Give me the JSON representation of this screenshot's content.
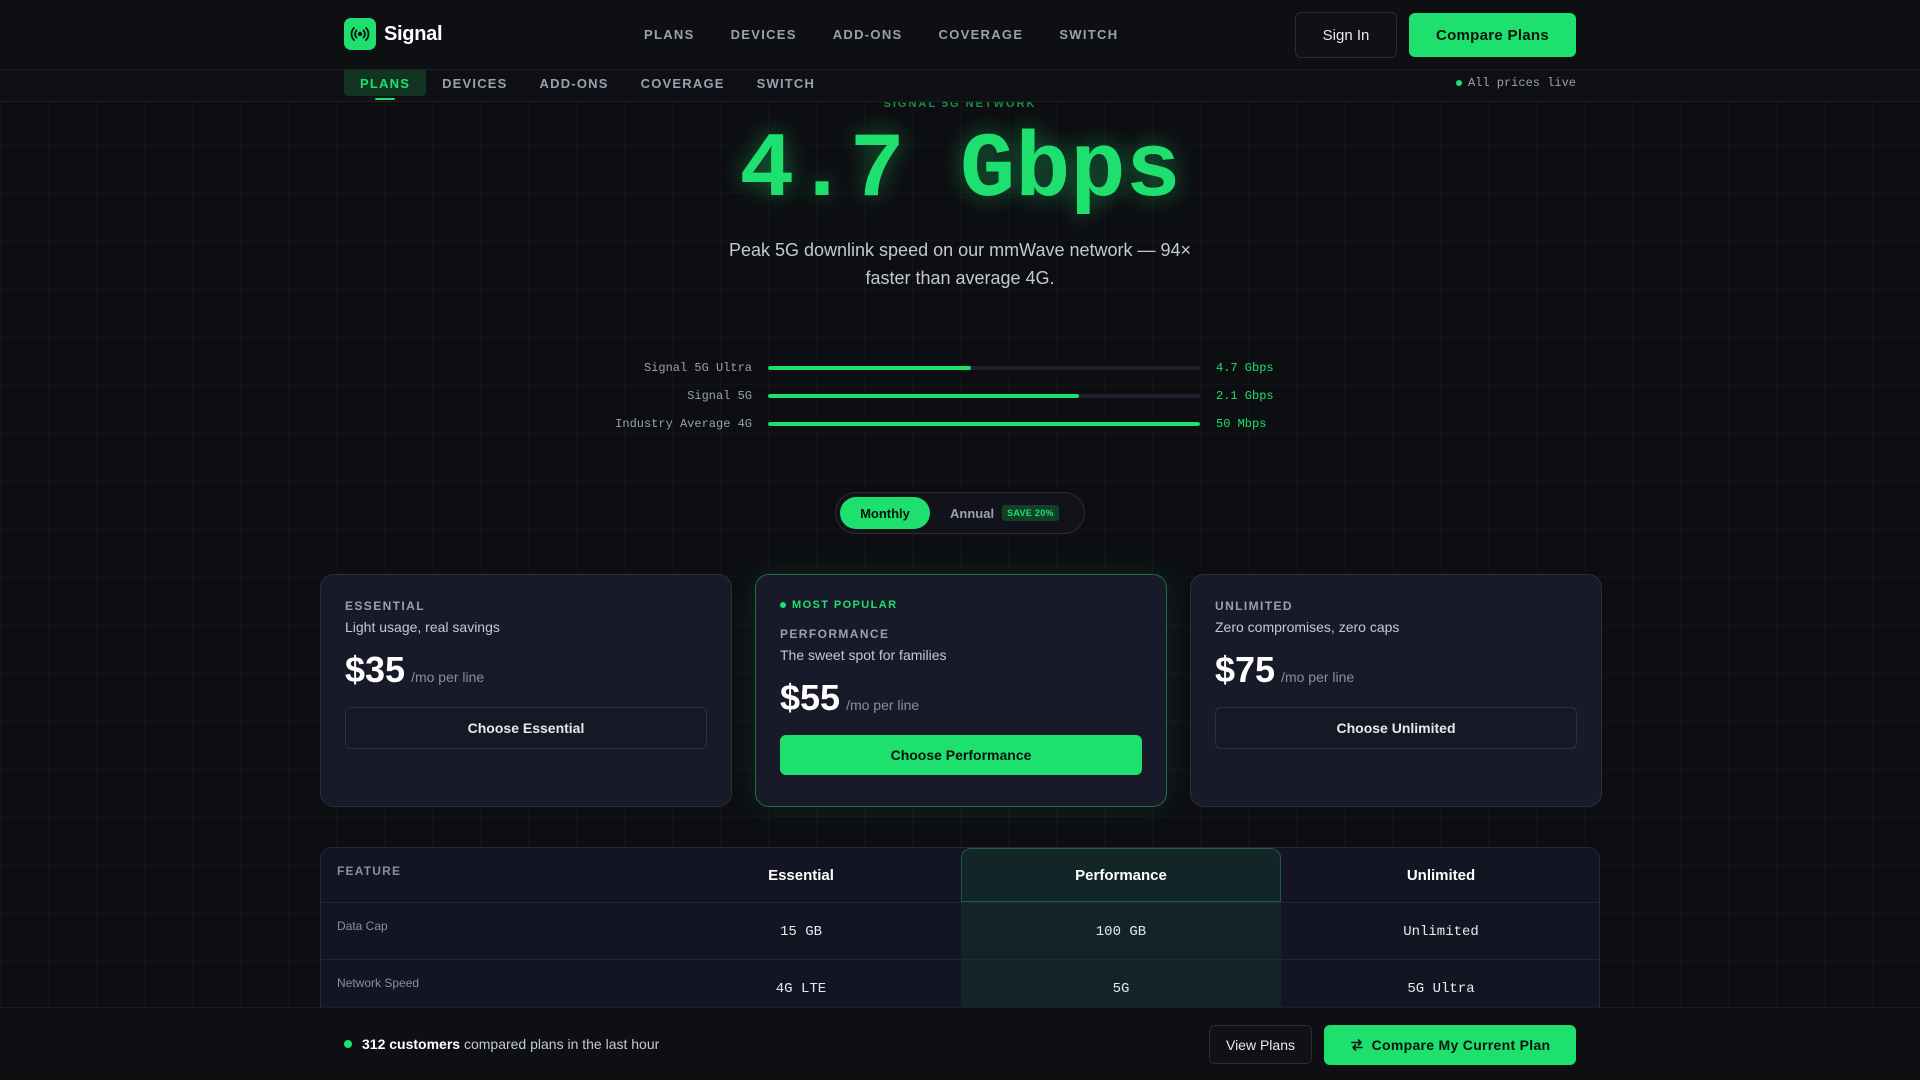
{
  "brand": {
    "name": "Signal",
    "logo_icon": "signal-broadcast-icon"
  },
  "topnav": {
    "links": [
      "PLANS",
      "DEVICES",
      "ADD-ONS",
      "COVERAGE",
      "SWITCH"
    ],
    "sign_in": "Sign In",
    "compare_plans": "Compare Plans"
  },
  "subnav": {
    "tabs": [
      "PLANS",
      "DEVICES",
      "ADD-ONS",
      "COVERAGE",
      "SWITCH"
    ],
    "active_tab": "PLANS",
    "live_status": "All prices live"
  },
  "hero": {
    "eyebrow": "SIGNAL 5G NETWORK",
    "speed": "4.7 Gbps",
    "subtitle": "Peak 5G downlink speed on our mmWave network — 94× faster than average 4G."
  },
  "speed_comparison": [
    {
      "label": "Signal 5G Ultra",
      "value": "4.7 Gbps",
      "fill": 0.47
    },
    {
      "label": "Signal 5G",
      "value": "2.1 Gbps",
      "fill": 0.72
    },
    {
      "label": "Industry Average 4G",
      "value": "50 Mbps",
      "fill": 1.0
    }
  ],
  "billing_toggle": {
    "monthly": "Monthly",
    "annual": "Annual",
    "annual_badge": "SAVE 20%",
    "selected": "Monthly"
  },
  "plans": [
    {
      "name": "ESSENTIAL",
      "desc": "Light usage, real savings",
      "price": "$35",
      "unit": "/mo per line",
      "cta": "Choose Essential"
    },
    {
      "badge": "MOST POPULAR",
      "name": "PERFORMANCE",
      "desc": "The sweet spot for families",
      "price": "$55",
      "unit": "/mo per line",
      "cta": "Choose Performance"
    },
    {
      "name": "UNLIMITED",
      "desc": "Zero compromises, zero caps",
      "price": "$75",
      "unit": "/mo per line",
      "cta": "Choose Unlimited"
    }
  ],
  "comparison_table": {
    "feature_header": "FEATURE",
    "columns": [
      "Essential",
      "Performance",
      "Unlimited"
    ],
    "rows": [
      {
        "feature": "Data Cap",
        "values": [
          "15 GB",
          "100 GB",
          "Unlimited"
        ]
      },
      {
        "feature": "Network Speed",
        "values": [
          "4G LTE",
          "5G",
          "5G Ultra"
        ]
      }
    ]
  },
  "bottom_bar": {
    "customers": "312 customers",
    "message": "compared plans in the last hour",
    "view_plans": "View Plans",
    "compare_current": "Compare My Current Plan",
    "compare_icon": "swap-arrows-icon"
  },
  "colors": {
    "accent": "#1ee06e",
    "background": "#0d0e12",
    "card": "#181a2a"
  }
}
